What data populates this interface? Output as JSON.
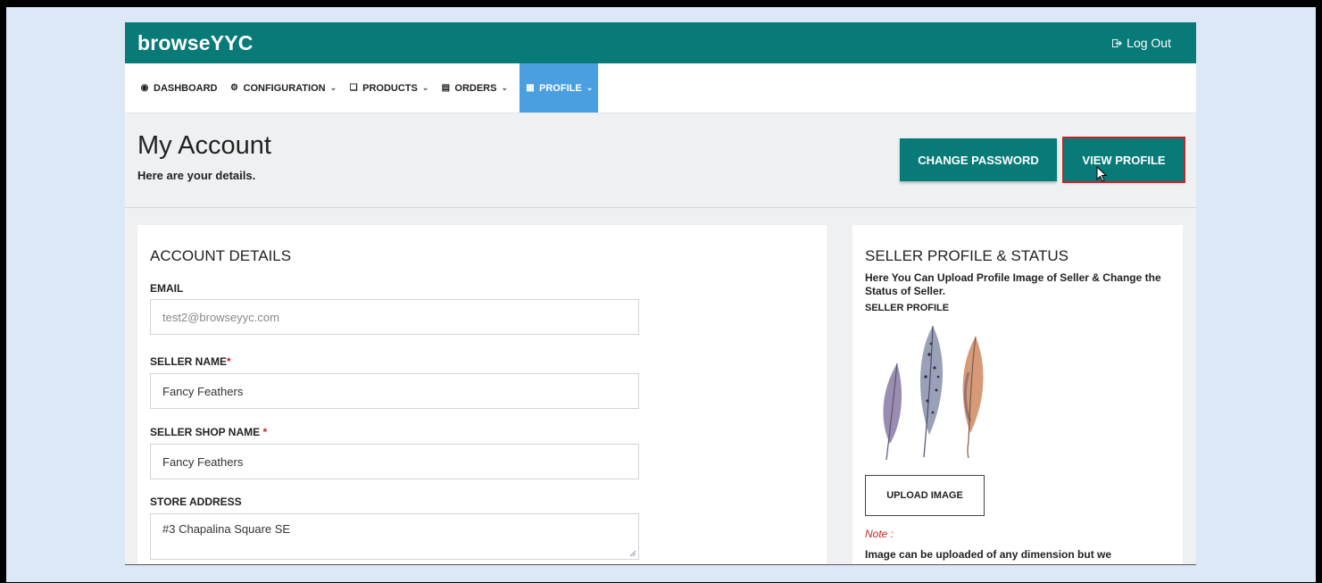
{
  "header": {
    "brand": "browseYYC",
    "logout_label": "Log Out",
    "color": "#087a78"
  },
  "nav": {
    "items": [
      {
        "label": "DASHBOARD",
        "icon": "dashboard-icon",
        "dropdown": false,
        "active": false
      },
      {
        "label": "CONFIGURATION",
        "icon": "gear-icon",
        "dropdown": true,
        "active": false
      },
      {
        "label": "PRODUCTS",
        "icon": "tag-icon",
        "dropdown": true,
        "active": false
      },
      {
        "label": "ORDERS",
        "icon": "orders-icon",
        "dropdown": true,
        "active": false
      },
      {
        "label": "PROFILE",
        "icon": "id-card-icon",
        "dropdown": true,
        "active": true
      }
    ],
    "active_color": "#4a9fe0"
  },
  "page": {
    "title": "My Account",
    "subtitle": "Here are your details.",
    "change_password_label": "CHANGE PASSWORD",
    "view_profile_label": "VIEW PROFILE"
  },
  "account": {
    "title": "ACCOUNT DETAILS",
    "email_label": "EMAIL",
    "email_value": "test2@browseyyc.com",
    "seller_name_label": "SELLER NAME",
    "seller_name_value": "Fancy Feathers",
    "shop_name_label": "SELLER SHOP NAME ",
    "shop_name_value": "Fancy Feathers",
    "address_label": "STORE ADDRESS",
    "address_value": "#3 Chapalina Square SE",
    "required_mark": "*"
  },
  "seller_profile": {
    "title": "SELLER PROFILE & STATUS",
    "description": "Here You Can Upload Profile Image of Seller & Change the Status of Seller.",
    "subheading": "SELLER PROFILE",
    "upload_label": "UPLOAD IMAGE",
    "note_label": "Note :",
    "note_text": "Image can be uploaded of any dimension but we"
  }
}
